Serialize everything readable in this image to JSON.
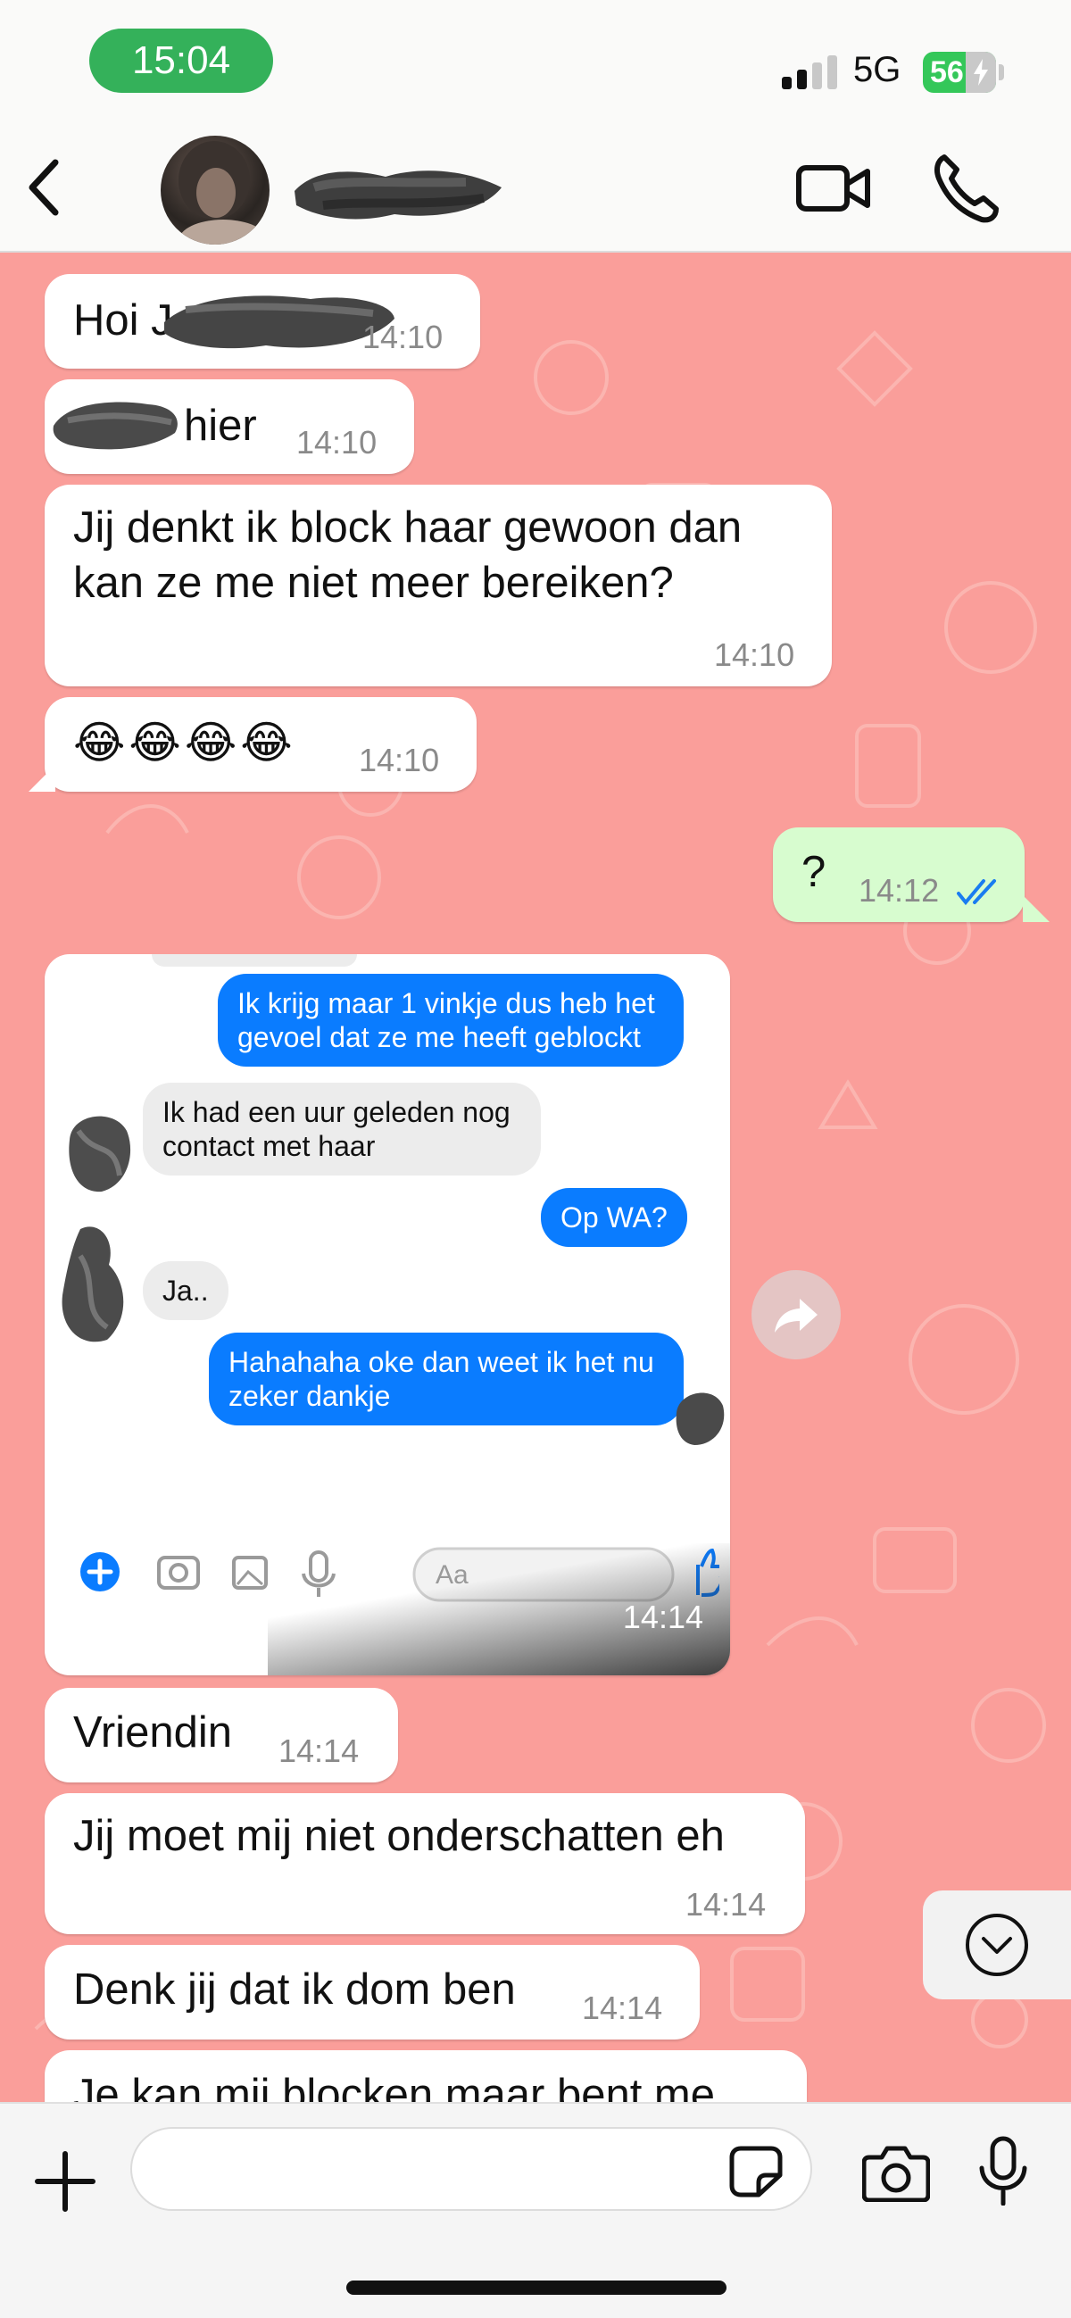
{
  "status_bar": {
    "time": "15:04",
    "network": "5G",
    "battery": "56"
  },
  "header": {
    "back_icon": "chevron-left-icon",
    "video_icon": "video-camera-icon",
    "call_icon": "phone-icon"
  },
  "colors": {
    "chat_background": "#fa9e9a",
    "incoming_bubble": "#ffffff",
    "outgoing_bubble": "#d7fccf",
    "read_ticks": "#1a7cf0",
    "time_pill": "#34b15a",
    "messenger_blue": "#0a7cff"
  },
  "messages": [
    {
      "text": "Hoi J",
      "time": "14:10"
    },
    {
      "text": "hier",
      "time": "14:10"
    },
    {
      "line1": "Jij denkt ik block haar gewoon dan",
      "line2": "kan ze me niet meer bereiken?",
      "time": "14:10"
    },
    {
      "text": "😂😂😂😂",
      "time": "14:10"
    },
    {
      "text": "?",
      "time": "14:12",
      "status_icon": "double-check-read-icon"
    },
    {
      "time": "14:14"
    },
    {
      "text": "Vriendin",
      "time": "14:14"
    },
    {
      "text": "Jij moet mij niet onderschatten eh",
      "time": "14:14"
    },
    {
      "text": "Denk jij dat ik dom ben",
      "time": "14:14"
    },
    {
      "text": "Je kan mij blocken maar bent me"
    }
  ],
  "screenshot": {
    "m1_line1": "Ik krijg maar 1 vinkje dus heb het",
    "m1_line2": "gevoel dat ze me heeft geblockt",
    "m2_line1": "Ik had een uur geleden nog",
    "m2_line2": "contact met haar",
    "m3": "Op WA?",
    "m4": "Ja..",
    "m5_line1": "Hahahaha oke dan weet ik het nu",
    "m5_line2": "zeker dankje",
    "input_placeholder": "Aa"
  },
  "composer": {
    "placeholder": ""
  },
  "icons": {
    "forward": "forward-arrow-icon",
    "scroll_down": "chevron-down-circle-icon",
    "plus": "plus-icon",
    "sticker": "sticker-icon",
    "camera": "camera-icon",
    "mic": "microphone-icon"
  }
}
